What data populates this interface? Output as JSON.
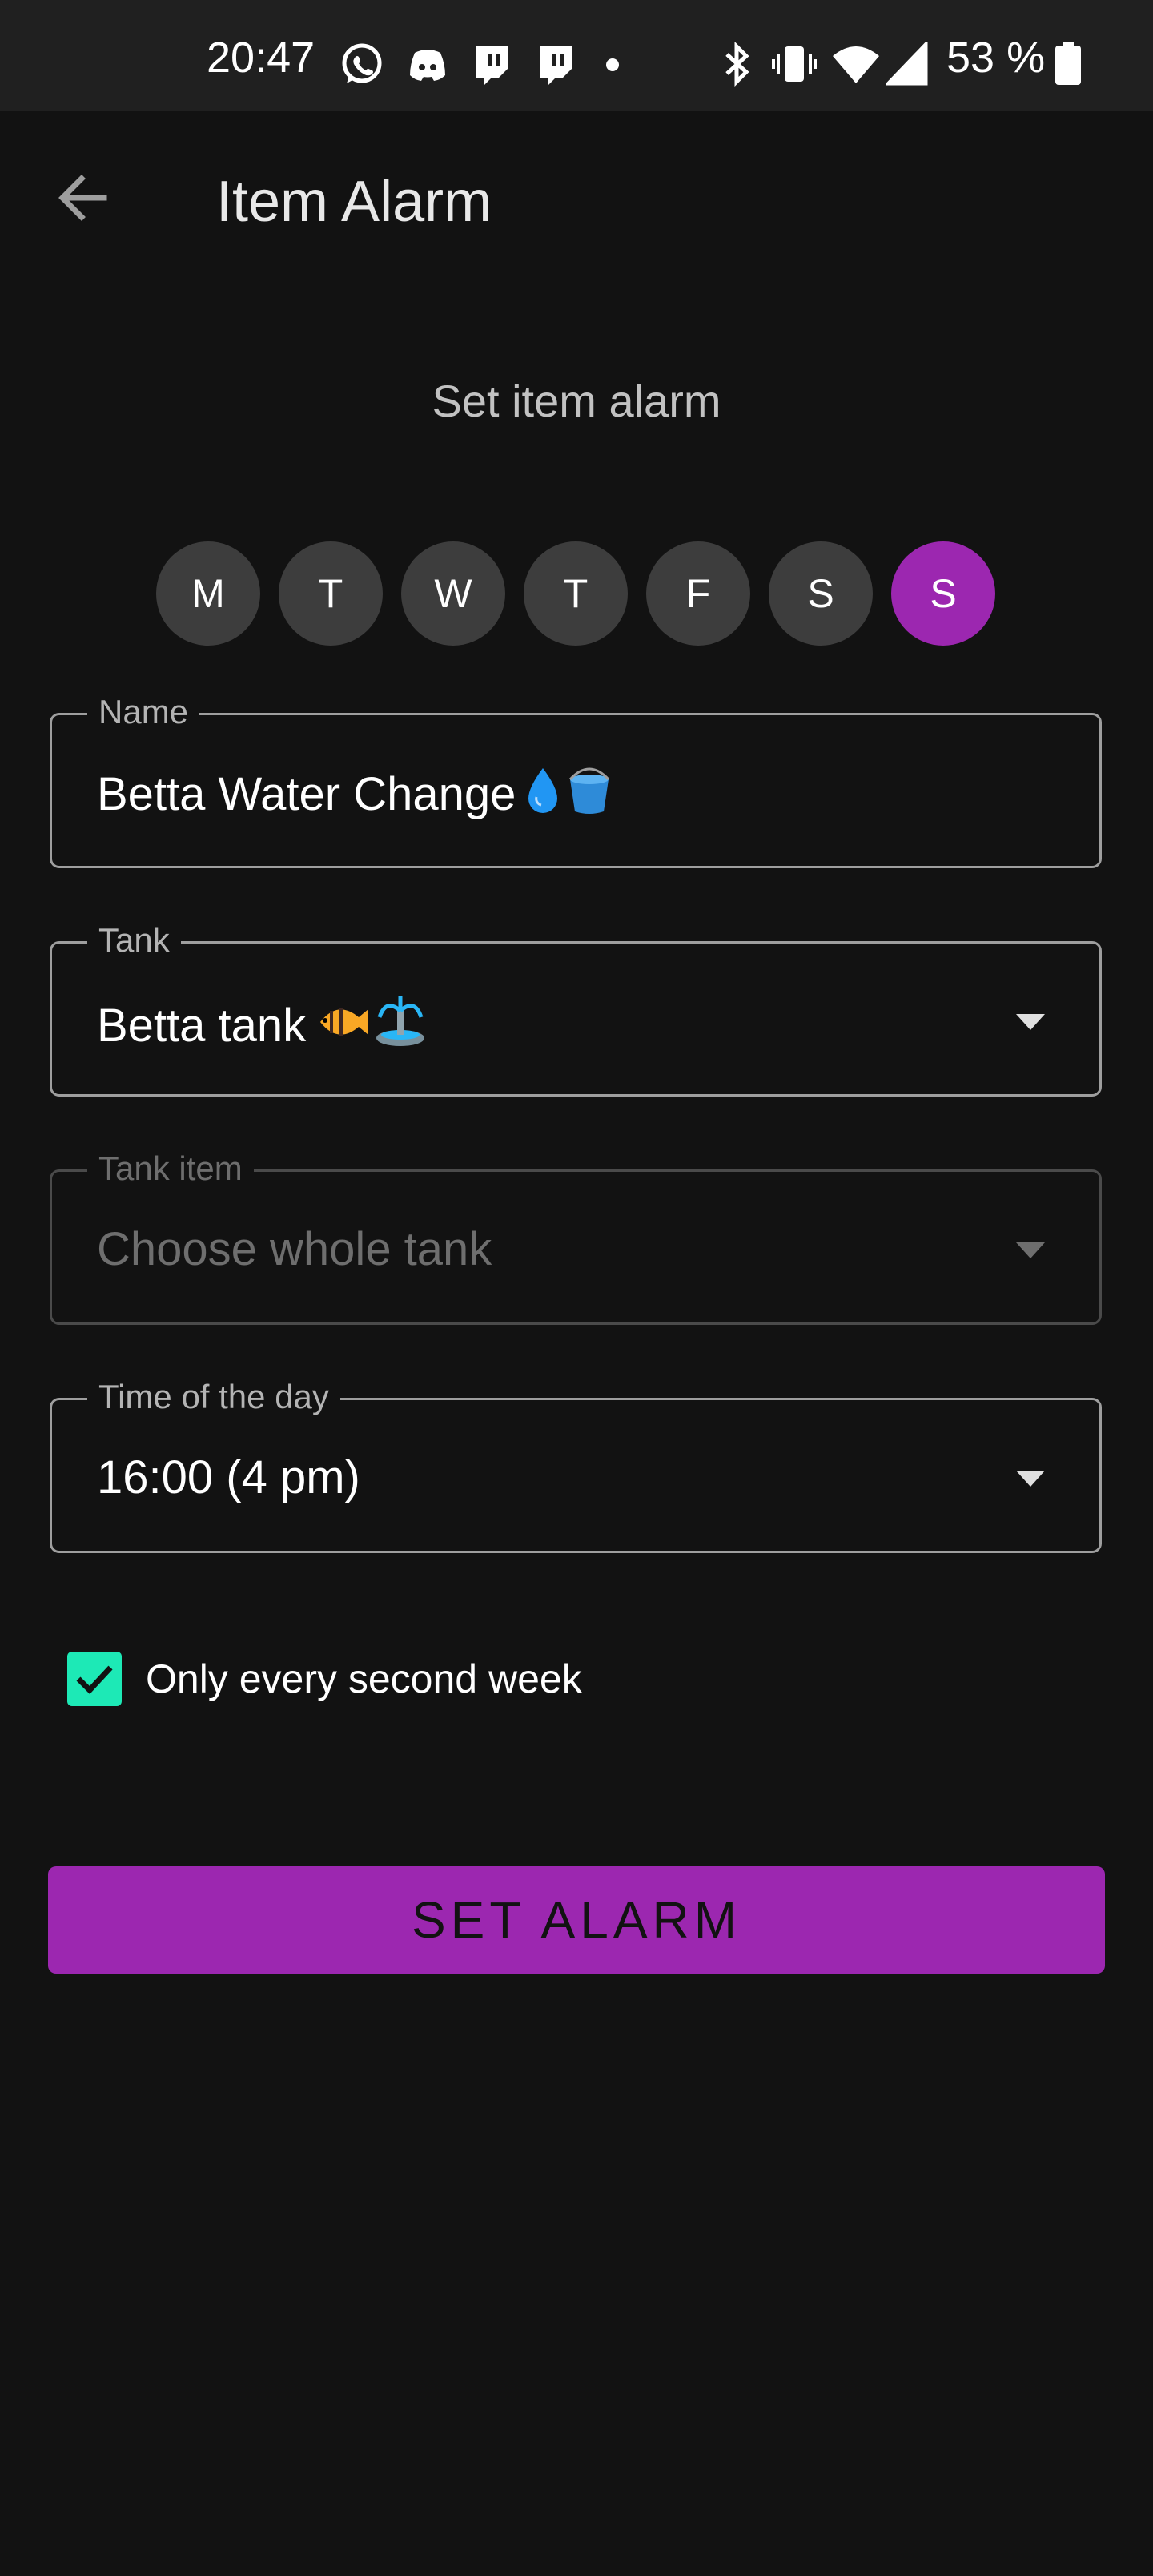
{
  "status_bar": {
    "time": "20:47",
    "battery_text": "53 %",
    "icons": [
      "whatsapp-icon",
      "discord-icon",
      "twitch-icon",
      "twitch-icon",
      "dot-icon",
      "bluetooth-icon",
      "vibrate-icon",
      "wifi-icon",
      "signal-icon",
      "battery-icon"
    ]
  },
  "app_bar": {
    "title": "Item Alarm",
    "back_icon": "arrow-back-icon"
  },
  "heading": "Set item alarm",
  "days": [
    {
      "label": "M",
      "selected": false
    },
    {
      "label": "T",
      "selected": false
    },
    {
      "label": "W",
      "selected": false
    },
    {
      "label": "T",
      "selected": false
    },
    {
      "label": "F",
      "selected": false
    },
    {
      "label": "S",
      "selected": false
    },
    {
      "label": "S",
      "selected": true
    }
  ],
  "fields": {
    "name": {
      "label": "Name",
      "value": "Betta Water Change",
      "emoji": "💧🪣"
    },
    "tank": {
      "label": "Tank",
      "value": "Betta tank",
      "emoji": "🐠⛲"
    },
    "tank_item": {
      "label": "Tank item",
      "value": "Choose whole tank",
      "disabled": true
    },
    "time": {
      "label": "Time of the day",
      "value": "16:00 (4 pm)"
    }
  },
  "checkbox": {
    "label": "Only every second week",
    "checked": true
  },
  "button": {
    "label": "SET ALARM"
  },
  "colors": {
    "accent": "#9c27b0",
    "checkbox": "#1de9b6",
    "background": "#121212",
    "status_bar": "#202020",
    "chip": "#3d3d3d"
  }
}
